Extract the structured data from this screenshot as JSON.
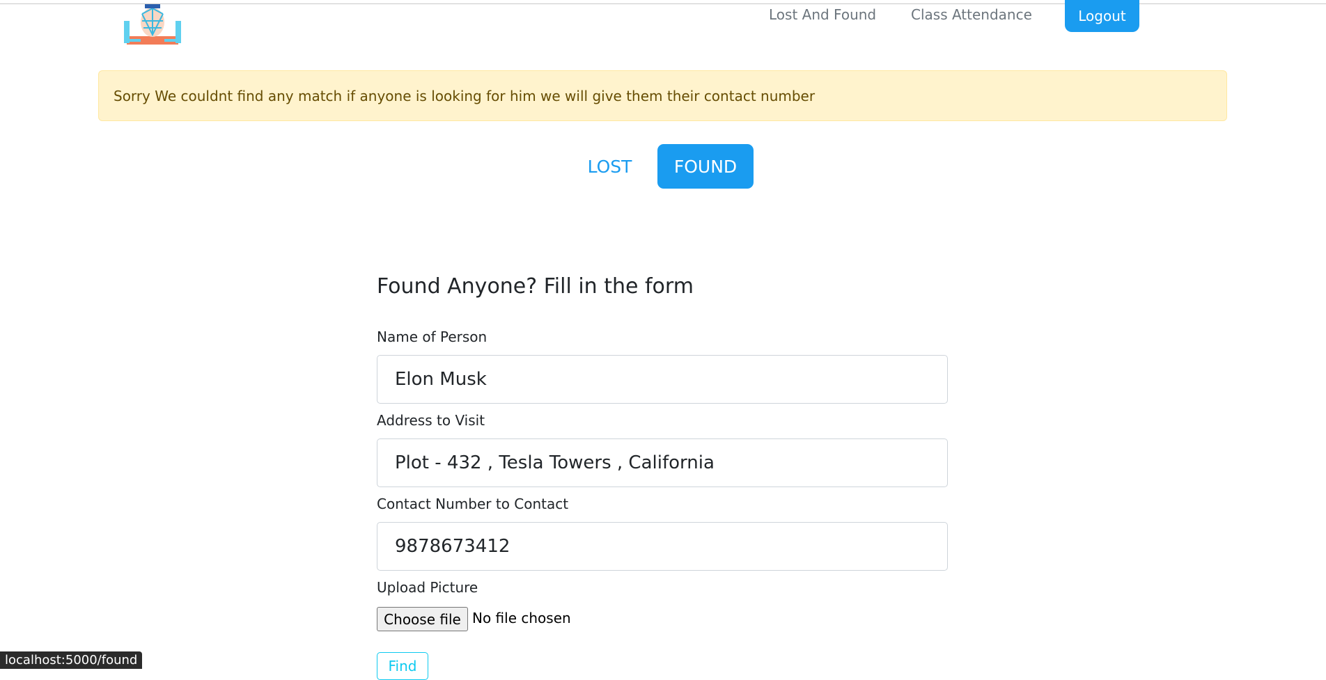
{
  "nav": {
    "logo_icon": "face-scan-logo-icon",
    "links": [
      "Lost And Found",
      "Class Attendance"
    ],
    "logout_label": "Logout",
    "accent_color": "#1a9cf0"
  },
  "alert": {
    "message": "Sorry We couldnt find any match if anyone is looking for him we will give them their contact number"
  },
  "tabs": {
    "lost_label": "LOST",
    "found_label": "FOUND",
    "active": "FOUND"
  },
  "form": {
    "title": "Found Anyone? Fill in the form",
    "name_label": "Name of Person",
    "name_value": "Elon Musk",
    "address_label": "Address to Visit",
    "address_value": "Plot - 432 , Tesla Towers , California",
    "contact_label": "Contact Number to Contact",
    "contact_value": "9878673412",
    "upload_label": "Upload Picture",
    "choose_file_label": "Choose file",
    "file_status": "No file chosen",
    "submit_label": "Find"
  },
  "status_bar": {
    "url": "localhost:5000/found"
  }
}
